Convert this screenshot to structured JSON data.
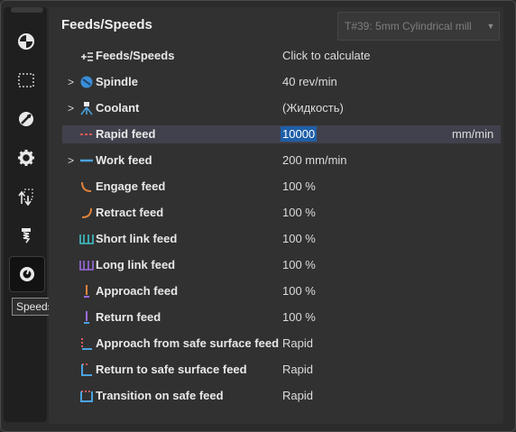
{
  "panel": {
    "title": "Feeds/Speeds"
  },
  "tool_select": {
    "value": "T#39: 5mm Cylindrical mill"
  },
  "sidebar": {
    "icons": [
      "model-icon",
      "workpiece-icon",
      "operation-icon",
      "settings-icon",
      "transition-icon",
      "tool-icon",
      "speeds-icon"
    ],
    "tooltip": "Speeds"
  },
  "rows": [
    {
      "label": "Feeds/Speeds",
      "value": "Click to calculate"
    },
    {
      "label": "Spindle",
      "value": "40 rev/min"
    },
    {
      "label": "Coolant",
      "value": "(Жидкость)"
    },
    {
      "label": "Rapid feed",
      "value": "10000",
      "unit": "mm/min"
    },
    {
      "label": "Work feed",
      "value": "200 mm/min"
    },
    {
      "label": "Engage feed",
      "value": "100 %"
    },
    {
      "label": "Retract feed",
      "value": "100 %"
    },
    {
      "label": "Short link feed",
      "value": "100 %"
    },
    {
      "label": "Long link feed",
      "value": "100 %"
    },
    {
      "label": "Approach feed",
      "value": "100 %"
    },
    {
      "label": "Return feed",
      "value": "100 %"
    },
    {
      "label": "Approach from safe surface feed",
      "value": "Rapid"
    },
    {
      "label": "Return to safe surface feed",
      "value": "Rapid"
    },
    {
      "label": "Transition on safe feed",
      "value": "Rapid"
    }
  ],
  "colors": {
    "accent": "#1f5fa8",
    "rapid": "#e05a5a",
    "work": "#4aa3e0",
    "arc": "#e0823a",
    "link_short": "#3fc2c8",
    "link_long": "#9a6be0"
  }
}
